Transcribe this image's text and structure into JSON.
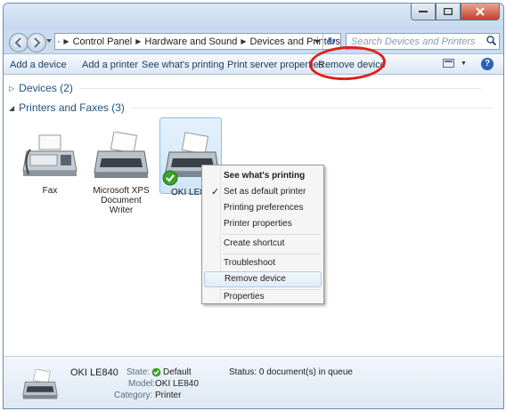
{
  "window": {
    "controls": {
      "minimize": "minimize-icon",
      "maximize": "maximize-icon",
      "close": "close-icon"
    }
  },
  "navigation": {
    "breadcrumbs": [
      "Control Panel",
      "Hardware and Sound",
      "Devices and Printers"
    ],
    "search_placeholder": "Search Devices and Printers"
  },
  "toolbar": {
    "add_device": "Add a device",
    "add_printer": "Add a printer",
    "see_printing": "See what's printing",
    "print_server": "Print server properties",
    "remove_device": "Remove device"
  },
  "groups": {
    "devices": "Devices (2)",
    "printers": "Printers and Faxes (3)"
  },
  "devices": [
    {
      "label": "Fax"
    },
    {
      "label": "Microsoft XPS Document Writer"
    },
    {
      "label": "OKI LE8"
    }
  ],
  "context_menu": {
    "items": [
      "See what's printing",
      "Set as default printer",
      "Printing preferences",
      "Printer properties",
      "Create shortcut",
      "Troubleshoot",
      "Remove device",
      "Properties"
    ]
  },
  "details": {
    "name": "OKI LE840",
    "state_label": "State:",
    "state_value": "Default",
    "status": "Status: 0 document(s) in queue",
    "model_label": "Model:",
    "model_value": "OKI LE840",
    "category_label": "Category:",
    "category_value": "Printer"
  },
  "colors": {
    "annotation": "#e02018",
    "accent": "#1e395b"
  }
}
